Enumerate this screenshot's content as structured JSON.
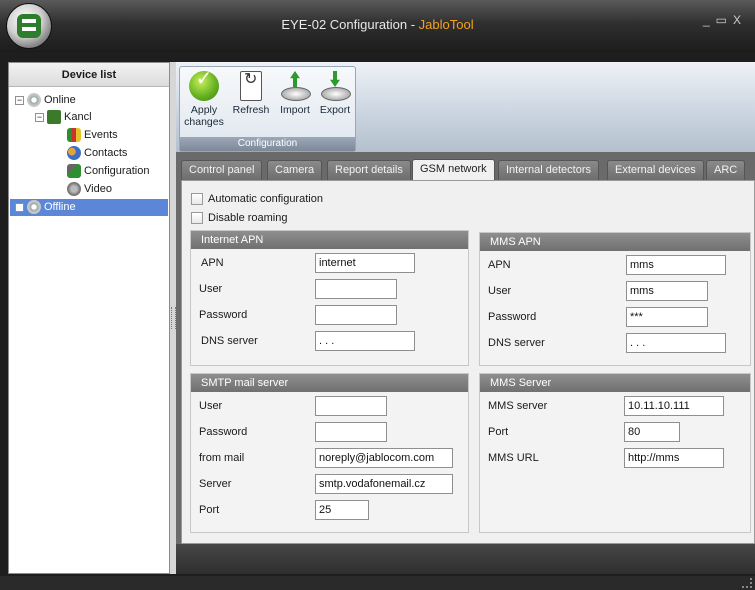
{
  "window": {
    "title_prefix": "EYE-02 Configuration - ",
    "title_brand": "JabloTool",
    "minimize_glyph": "_",
    "maximize_glyph": "▭",
    "close_glyph": "X"
  },
  "colors": {
    "brand": "#f2a21f",
    "selected": "#5c86d8",
    "apply_green": "#68b323"
  },
  "sidebar": {
    "header": "Device list",
    "items": [
      {
        "label": "Online",
        "icon": "gear-icon",
        "expander": "−"
      },
      {
        "label": "Kancl",
        "icon": "device-icon",
        "expander": "−"
      },
      {
        "label": "Events",
        "icon": "events-icon"
      },
      {
        "label": "Contacts",
        "icon": "contacts-icon"
      },
      {
        "label": "Configuration",
        "icon": "configuration-icon"
      },
      {
        "label": "Video",
        "icon": "video-icon"
      },
      {
        "label": "Offline",
        "icon": "gear-icon",
        "expander": "+",
        "selected": true
      }
    ]
  },
  "toolbar": {
    "group_caption": "Configuration",
    "apply_label_1": "Apply",
    "apply_label_2": "changes",
    "refresh_label": "Refresh",
    "import_label": "Import",
    "export_label": "Export"
  },
  "tabs": [
    {
      "label": "Control panel"
    },
    {
      "label": "Camera"
    },
    {
      "label": "Report details"
    },
    {
      "label": "GSM network",
      "active": true
    },
    {
      "label": "Internal detectors"
    },
    {
      "label": "External devices"
    },
    {
      "label": "ARC"
    }
  ],
  "gsm": {
    "auto_config_label": "Automatic configuration",
    "disable_roaming_label": "Disable roaming",
    "internet_apn": {
      "title": "Internet APN",
      "apn_label": "APN",
      "apn_value": "internet",
      "user_label": "User",
      "user_value": "",
      "password_label": "Password",
      "password_value": "",
      "dns_label": "DNS server",
      "dns_value": ". . ."
    },
    "mms_apn": {
      "title": "MMS APN",
      "apn_label": "APN",
      "apn_value": "mms",
      "user_label": "User",
      "user_value": "mms",
      "password_label": "Password",
      "password_value": "***",
      "dns_label": "DNS server",
      "dns_value": ". . ."
    },
    "smtp": {
      "title": "SMTP mail server",
      "user_label": "User",
      "user_value": "",
      "password_label": "Password",
      "password_value": "",
      "from_label": "from mail",
      "from_value": "noreply@jablocom.com",
      "server_label": "Server",
      "server_value": "smtp.vodafonemail.cz",
      "port_label": "Port",
      "port_value": "25"
    },
    "mms_server": {
      "title": "MMS Server",
      "server_label": "MMS server",
      "server_value": "10.11.10.111",
      "port_label": "Port",
      "port_value": "80",
      "url_label": "MMS URL",
      "url_value": "http://mms"
    }
  }
}
